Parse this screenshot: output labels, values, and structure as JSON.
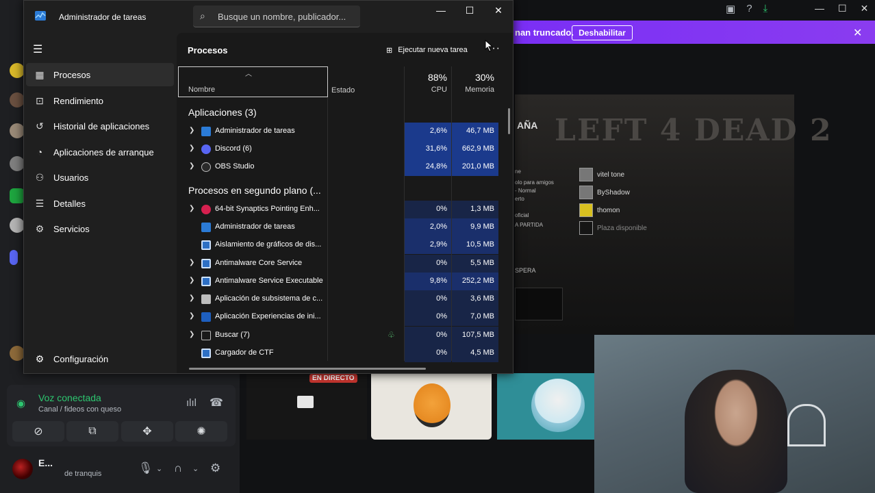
{
  "taskmgr": {
    "title": "Administrador de tareas",
    "search_placeholder": "Busque un nombre, publicador...",
    "nav": [
      {
        "label": "Procesos",
        "icon": "processes-icon"
      },
      {
        "label": "Rendimiento",
        "icon": "performance-icon"
      },
      {
        "label": "Historial de aplicaciones",
        "icon": "history-icon"
      },
      {
        "label": "Aplicaciones de arranque",
        "icon": "startup-icon"
      },
      {
        "label": "Usuarios",
        "icon": "users-icon"
      },
      {
        "label": "Detalles",
        "icon": "details-icon"
      },
      {
        "label": "Servicios",
        "icon": "services-icon"
      }
    ],
    "settings_label": "Configuración",
    "content_title": "Procesos",
    "run_task_label": "Ejecutar nueva tarea",
    "columns": {
      "name": "Nombre",
      "status": "Estado",
      "cpu_pct": "88%",
      "cpu": "CPU",
      "mem_pct": "30%",
      "mem": "Memoria"
    },
    "groups": {
      "apps_title": "Aplicaciones (3)",
      "bg_title": "Procesos en segundo plano (..."
    },
    "apps": [
      {
        "name": "Administrador de tareas",
        "cpu": "2,6%",
        "mem": "46,7 MB",
        "expand": true
      },
      {
        "name": "Discord (6)",
        "cpu": "31,6%",
        "mem": "662,9 MB",
        "expand": true
      },
      {
        "name": "OBS Studio",
        "cpu": "24,8%",
        "mem": "201,0 MB",
        "expand": true
      }
    ],
    "background": [
      {
        "name": "64-bit Synaptics Pointing Enh...",
        "cpu": "0%",
        "mem": "1,3 MB",
        "expand": true
      },
      {
        "name": "Administrador de tareas",
        "cpu": "2,0%",
        "mem": "9,9 MB",
        "expand": false
      },
      {
        "name": "Aislamiento de gráficos de dis...",
        "cpu": "2,9%",
        "mem": "10,5 MB",
        "expand": false
      },
      {
        "name": "Antimalware Core Service",
        "cpu": "0%",
        "mem": "5,5 MB",
        "expand": true
      },
      {
        "name": "Antimalware Service Executable",
        "cpu": "9,8%",
        "mem": "252,2 MB",
        "expand": true
      },
      {
        "name": "Aplicación de subsistema de c...",
        "cpu": "0%",
        "mem": "3,6 MB",
        "expand": true
      },
      {
        "name": "Aplicación Experiencias de ini...",
        "cpu": "0%",
        "mem": "7,0 MB",
        "expand": true
      },
      {
        "name": "Buscar (7)",
        "cpu": "0%",
        "mem": "107,5 MB",
        "expand": true
      },
      {
        "name": "Cargador de CTF",
        "cpu": "0%",
        "mem": "4,5 MB",
        "expand": false
      }
    ]
  },
  "discord": {
    "notice_text": "nan truncado.",
    "notice_button": "Deshabilitar",
    "voice_title": "Voz conectada",
    "voice_channel": "Canal / fideos con queso",
    "user_name": "E...",
    "user_status": "de tranquis",
    "live_badge": "EN DIRECTO"
  },
  "game": {
    "header": "AÑA",
    "menu": [
      "ne",
      "olo para amigos",
      "- Normal",
      "erto",
      "oficial",
      "A PARTIDA"
    ],
    "players": [
      "vitel tone",
      "ByShadow",
      "thomon",
      "Plaza disponible"
    ],
    "wait_label": "SPERA",
    "logo_text": "LEFT 4 DEAD 2"
  }
}
